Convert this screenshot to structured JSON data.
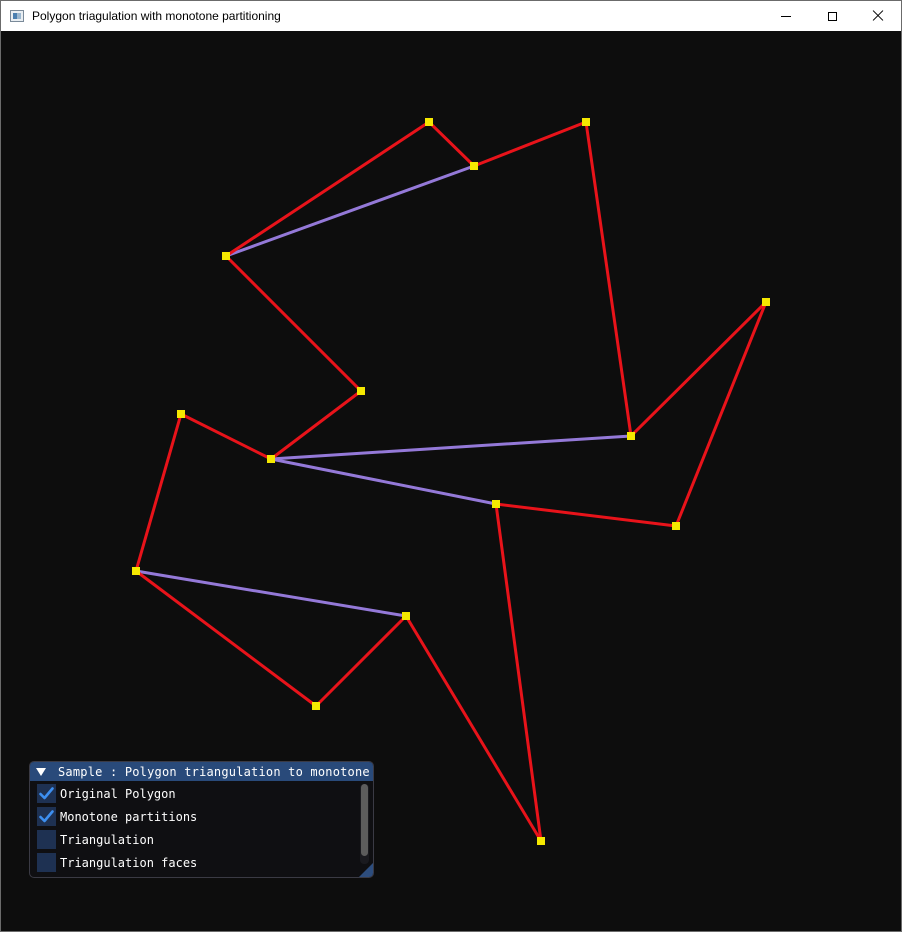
{
  "window": {
    "title": "Polygon triagulation with monotone partitioning",
    "icon": "app-window-icon",
    "controls": [
      "minimize-icon",
      "maximize-icon",
      "close-icon"
    ]
  },
  "panel": {
    "title": "Sample : Polygon triangulation to monotone pi",
    "checkboxes": [
      {
        "label": "Original Polygon",
        "checked": true
      },
      {
        "label": "Monotone partitions",
        "checked": true
      },
      {
        "label": "Triangulation",
        "checked": false
      },
      {
        "label": "Triangulation faces",
        "checked": false
      }
    ]
  },
  "colors": {
    "background": "#0d0d0d",
    "polygon_edge": "#e8131a",
    "partition_edge": "#9479d8",
    "vertex": "#f5e800",
    "checkbox_fill": "#1e3152",
    "checkmark": "#3d8ff0",
    "panel_header": "#294a7a"
  }
}
